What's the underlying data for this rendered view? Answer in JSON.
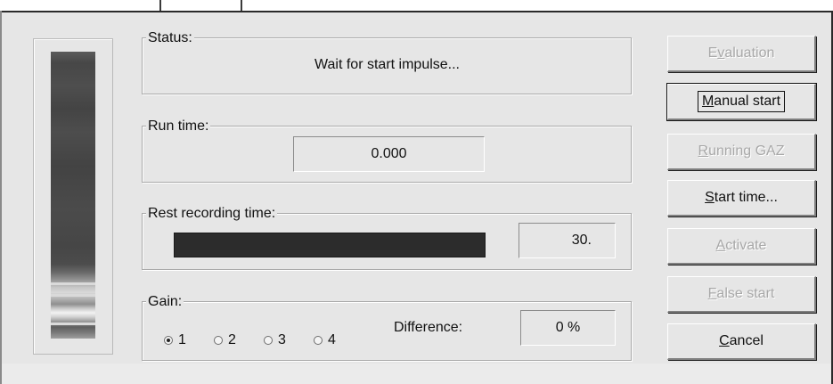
{
  "status": {
    "label": "Status:",
    "message": "Wait for start impulse..."
  },
  "run_time": {
    "label": "Run time:",
    "value": "0.000"
  },
  "rest_recording_time": {
    "label": "Rest recording time:",
    "value": "30.",
    "progress_fraction": 1.0
  },
  "gain": {
    "label": "Gain:",
    "options": [
      "1",
      "2",
      "3",
      "4"
    ],
    "selected": "1"
  },
  "difference": {
    "label": "Difference:",
    "value": "0 %"
  },
  "buttons": {
    "evaluation": {
      "pre": "E",
      "ul": "v",
      "post": "aluation",
      "enabled": false
    },
    "manual_start": {
      "pre": "",
      "ul": "M",
      "post": "anual start",
      "enabled": true
    },
    "running_gaz": {
      "pre": "",
      "ul": "R",
      "post": "unning GAZ",
      "enabled": false
    },
    "start_time": {
      "pre": "",
      "ul": "S",
      "post": "tart time...",
      "enabled": true
    },
    "activate": {
      "pre": "",
      "ul": "A",
      "post": "ctivate",
      "enabled": false
    },
    "false_start": {
      "pre": "",
      "ul": "F",
      "post": "alse start",
      "enabled": false
    },
    "cancel": {
      "pre": "",
      "ul": "C",
      "post": "ancel",
      "enabled": true
    }
  },
  "colors": {
    "dialog_bg": "#e6e6e6",
    "disabled_text": "#a8a8a8",
    "progress_fill": "#2c2c2c"
  }
}
